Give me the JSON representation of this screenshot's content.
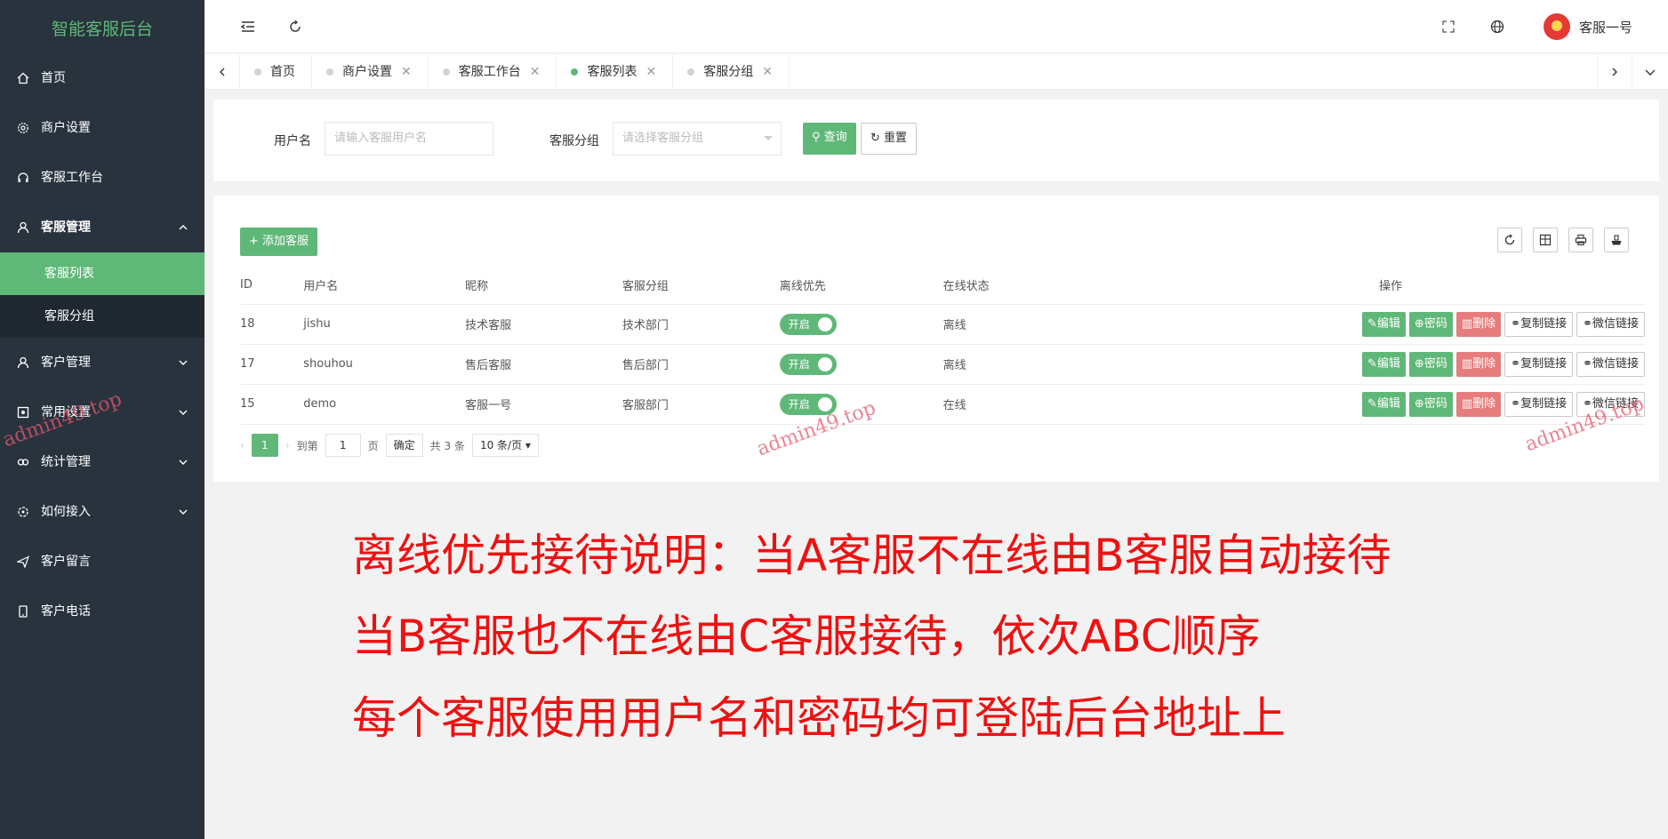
{
  "app": {
    "title": "智能客服后台"
  },
  "sidebar": {
    "items": [
      {
        "label": "首页",
        "icon": "home-icon"
      },
      {
        "label": "商户设置",
        "icon": "gear-icon"
      },
      {
        "label": "客服工作台",
        "icon": "headset-icon"
      },
      {
        "label": "客服管理",
        "icon": "user-icon",
        "expanded": true,
        "children": [
          {
            "label": "客服列表",
            "active": true
          },
          {
            "label": "客服分组"
          }
        ]
      },
      {
        "label": "客户管理",
        "icon": "user-icon"
      },
      {
        "label": "常用设置",
        "icon": "setting-icon"
      },
      {
        "label": "统计管理",
        "icon": "link-icon"
      },
      {
        "label": "如何接入",
        "icon": "plugin-icon"
      },
      {
        "label": "客户留言",
        "icon": "send-icon"
      },
      {
        "label": "客户电话",
        "icon": "phone-icon"
      }
    ]
  },
  "header": {
    "user_name": "客服一号"
  },
  "tabs": [
    {
      "label": "首页",
      "closable": false,
      "active": false
    },
    {
      "label": "商户设置",
      "closable": true,
      "active": false
    },
    {
      "label": "客服工作台",
      "closable": true,
      "active": false
    },
    {
      "label": "客服列表",
      "closable": true,
      "active": true
    },
    {
      "label": "客服分组",
      "closable": true,
      "active": false
    }
  ],
  "search": {
    "username_label": "用户名",
    "username_placeholder": "请输入客服用户名",
    "group_label": "客服分组",
    "group_placeholder": "请选择客服分组",
    "query_label": "查询",
    "reset_label": "重置"
  },
  "table": {
    "add_label": "添加客服",
    "columns": [
      "ID",
      "用户名",
      "昵称",
      "客服分组",
      "离线优先",
      "在线状态",
      "操作"
    ],
    "rows": [
      {
        "id": "18",
        "username": "jishu",
        "nickname": "技术客服",
        "group": "技术部门",
        "offline_first": "开启",
        "status": "离线"
      },
      {
        "id": "17",
        "username": "shouhou",
        "nickname": "售后客服",
        "group": "售后部门",
        "offline_first": "开启",
        "status": "离线"
      },
      {
        "id": "15",
        "username": "demo",
        "nickname": "客服一号",
        "group": "客服部门",
        "offline_first": "开启",
        "status": "在线"
      }
    ],
    "actions": {
      "edit": "编辑",
      "password": "密码",
      "delete": "删除",
      "copy_link": "复制链接",
      "wechat_link": "微信链接"
    }
  },
  "pagination": {
    "current": "1",
    "goto_label": "到第",
    "goto_value": "1",
    "page_unit": "页",
    "confirm_label": "确定",
    "total_label": "共 3 条",
    "page_size": "10 条/页"
  },
  "notes": [
    "离线优先接待说明：当A客服不在线由B客服自动接待",
    "当B客服也不在线由C客服接待，依次ABC顺序",
    "每个客服使用用户名和密码均可登陆后台地址上"
  ],
  "watermark": "admin49.top",
  "colors": {
    "accent": "#5fb878",
    "danger": "#e77c7c",
    "sidebar": "#28333e",
    "note": "#ee1111"
  }
}
